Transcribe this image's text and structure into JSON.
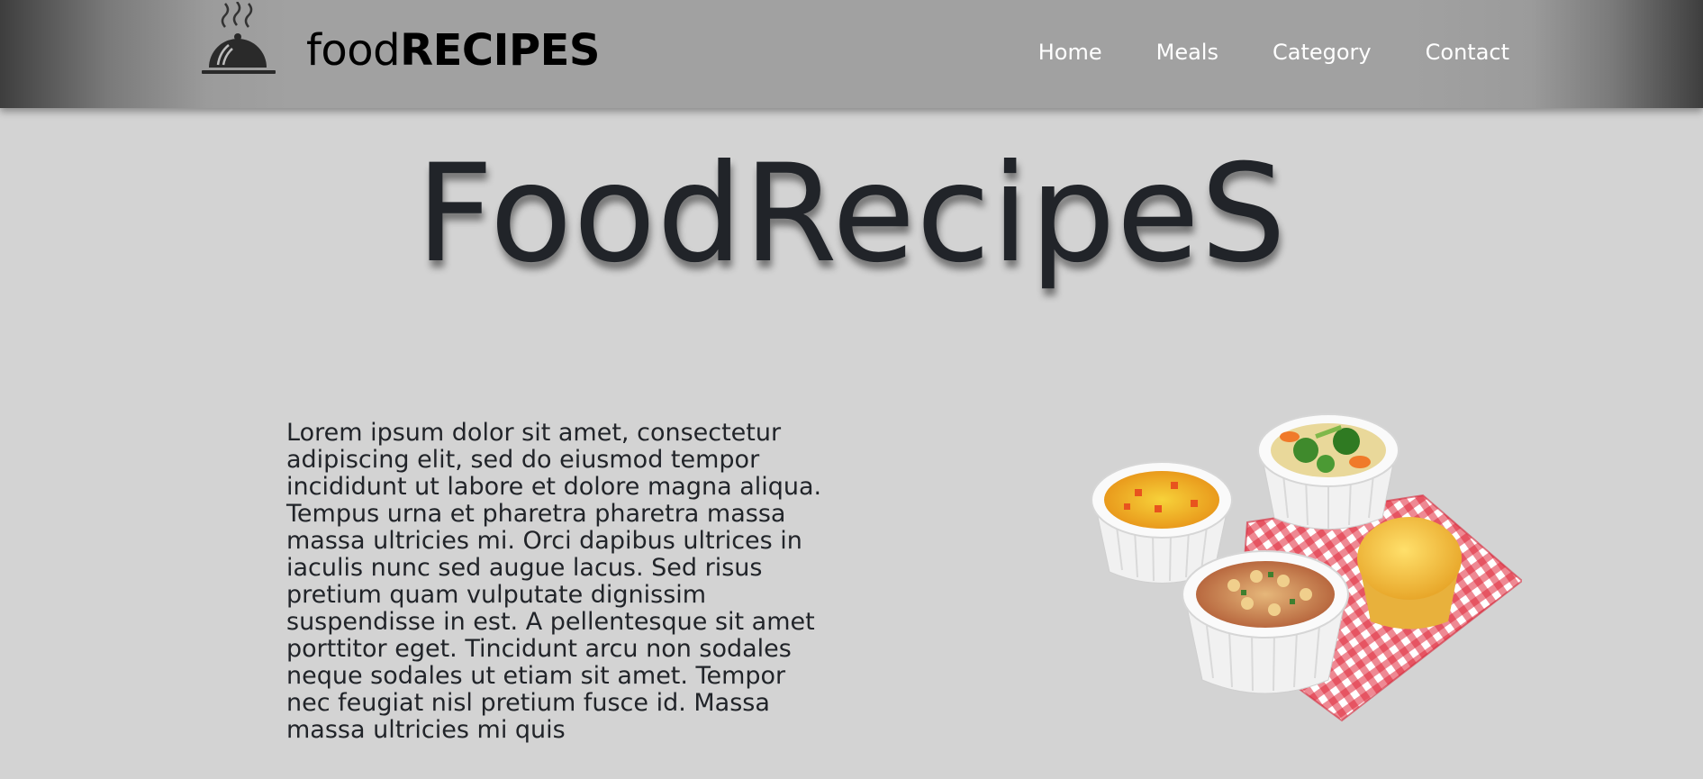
{
  "header": {
    "logo_icon": "serving-cloche-icon",
    "brand_light": "food",
    "brand_bold": "RECIPES",
    "nav": [
      {
        "label": "Home"
      },
      {
        "label": "Meals"
      },
      {
        "label": "Category"
      },
      {
        "label": "Contact"
      }
    ]
  },
  "hero": {
    "title": "FoodRecipeS"
  },
  "content": {
    "paragraph": "Lorem ipsum dolor sit amet, consectetur adipiscing elit, sed do eiusmod tempor incididunt ut labore et dolore magna aliqua. Tempus urna et pharetra pharetra massa massa ultricies mi. Orci dapibus ultrices in iaculis nunc sed augue lacus. Sed risus pretium quam vulputate dignissim suspendisse in est. A pellentesque sit amet porttitor eget. Tincidunt arcu non sodales neque sodales ut etiam sit amet. Tempor nec feugiat nisl pretium fusce id. Massa massa ultricies mi quis",
    "image": "food-bowls-image"
  },
  "colors": {
    "page_background": "#d3d3d3",
    "navbar": "#a1a1a1",
    "title_text": "#212429",
    "nav_text": "#ffffff"
  }
}
